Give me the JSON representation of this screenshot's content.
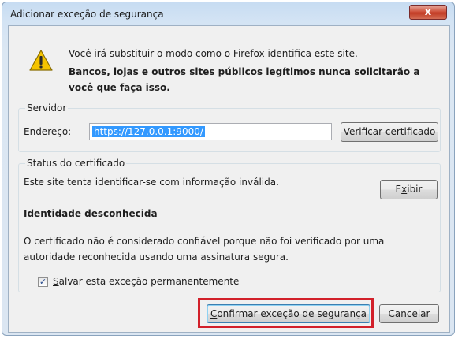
{
  "dialog": {
    "title": "Adicionar exceção de segurança",
    "close_label": "x"
  },
  "warning": {
    "line1": "Você irá substituir o modo como o Firefox identifica este site.",
    "line2": "Bancos, lojas e outros sites públicos legítimos nunca solicitarão a você que faça isso."
  },
  "server": {
    "group_label": "Servidor",
    "address_label": "Endereço:",
    "address_value": "https://127.0.0.1:9000/",
    "verify_button": {
      "prefix": "",
      "accel": "V",
      "rest": "erificar certificado"
    }
  },
  "status": {
    "group_label": "Status do certificado",
    "message": "Este site tenta identificar-se com informação inválida.",
    "view_button": {
      "prefix": "E",
      "accel": "x",
      "rest": "ibir"
    },
    "identity_heading": "Identidade desconhecida",
    "detail": "O certificado não é considerado confiável porque não foi verificado por uma autoridade reconhecida usando uma assinatura segura."
  },
  "permanent": {
    "checked": true,
    "check_glyph": "✓",
    "accel": "S",
    "rest": "alvar esta exceção permanentemente"
  },
  "buttons": {
    "confirm": {
      "accel": "C",
      "rest": "onfirmar exceção de segurança"
    },
    "cancel": "Cancelar"
  },
  "colors": {
    "highlight_border": "#d2202a",
    "selection": "#3399ff",
    "title_bar": "#c7dcf2"
  },
  "icons": {
    "warning": "warning-icon",
    "close": "close-icon"
  }
}
